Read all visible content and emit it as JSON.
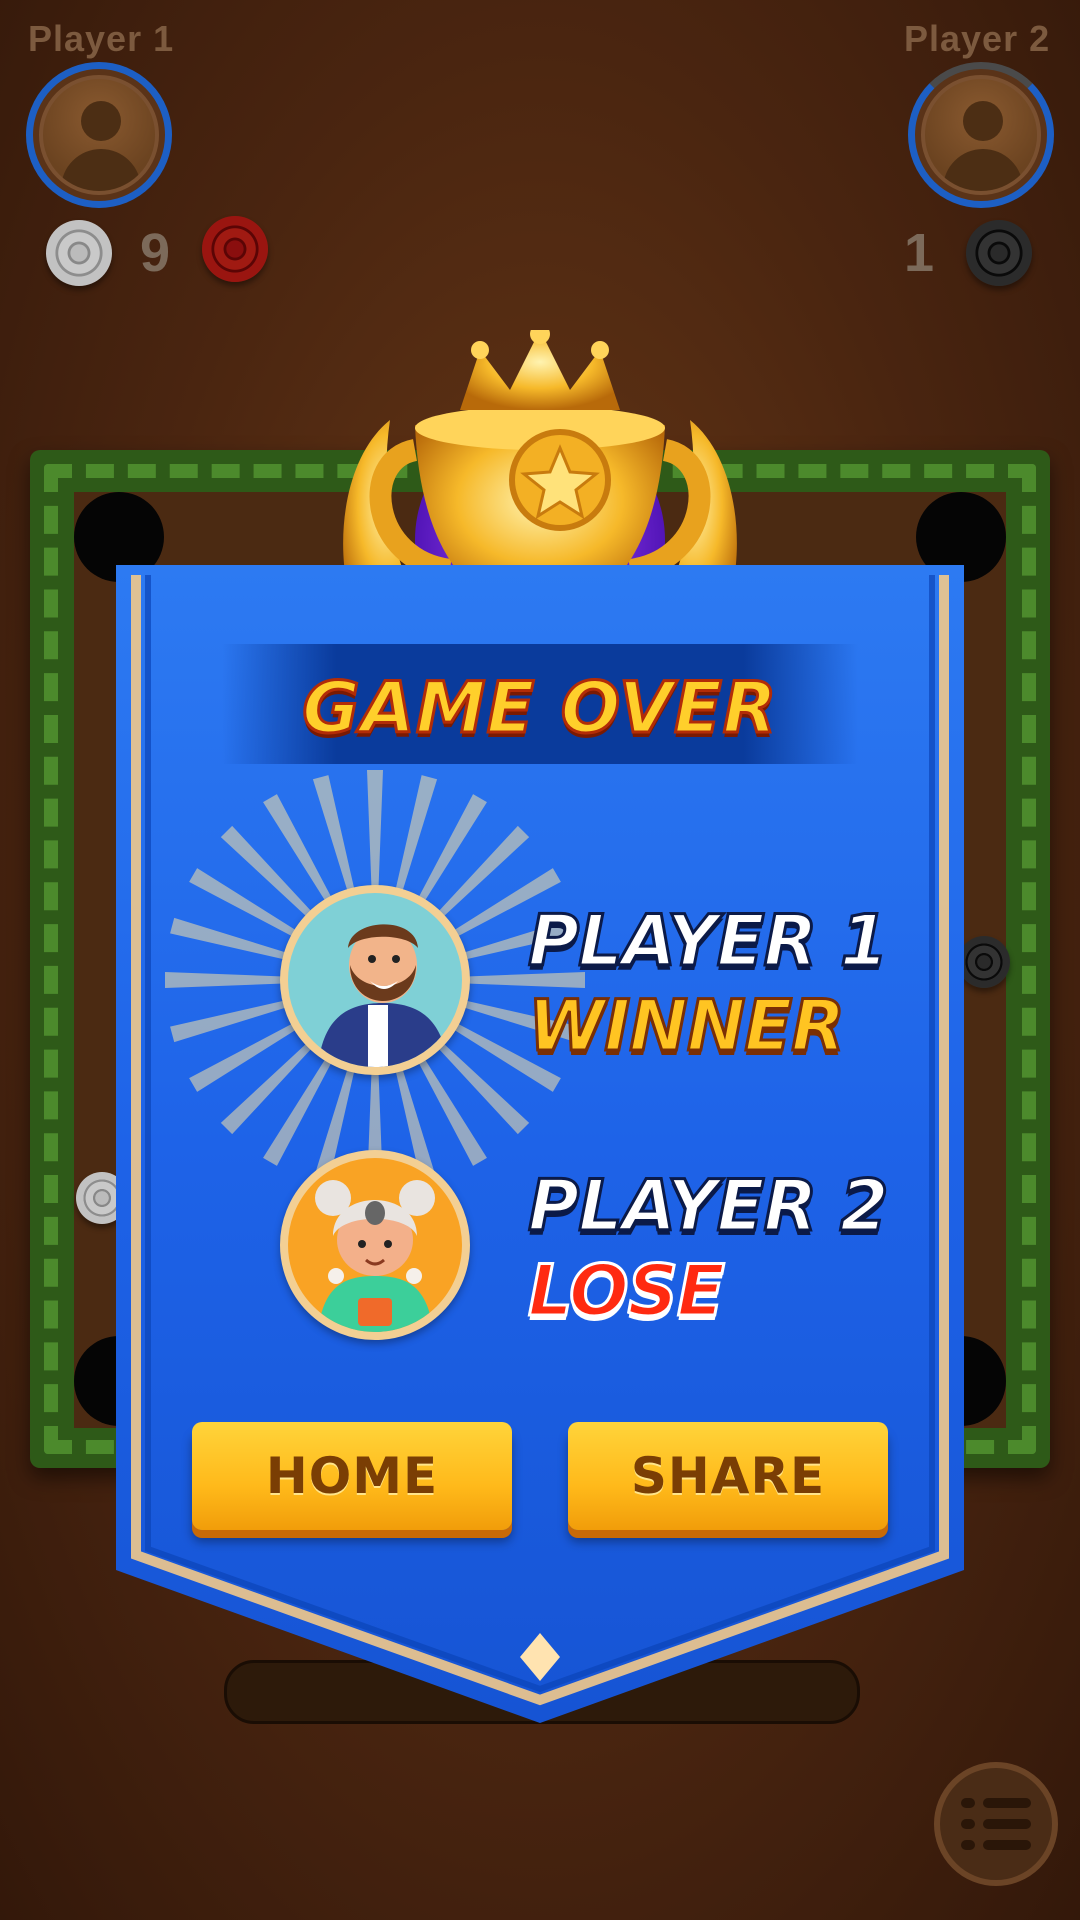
{
  "hud": {
    "player1": {
      "name": "Player 1",
      "score": "9"
    },
    "player2": {
      "name": "Player 2",
      "score": "1"
    }
  },
  "dialog": {
    "title": "GAME OVER",
    "results": [
      {
        "name": "PLAYER 1",
        "status": "WINNER"
      },
      {
        "name": "PLAYER 2",
        "status": "LOSE"
      }
    ],
    "buttons": {
      "home": "HOME",
      "share": "SHARE"
    }
  },
  "colors": {
    "banner_blue": "#1e63e8",
    "title_gold": "#ffcf2b",
    "winner_gold": "#ffc422",
    "lose_red": "#ff2a10",
    "button_gold": "#ffc422",
    "board_green": "#2e5a18"
  },
  "icons": {
    "avatar": "avatar-icon",
    "menu": "menu-list-icon",
    "trophy": "trophy-icon"
  }
}
